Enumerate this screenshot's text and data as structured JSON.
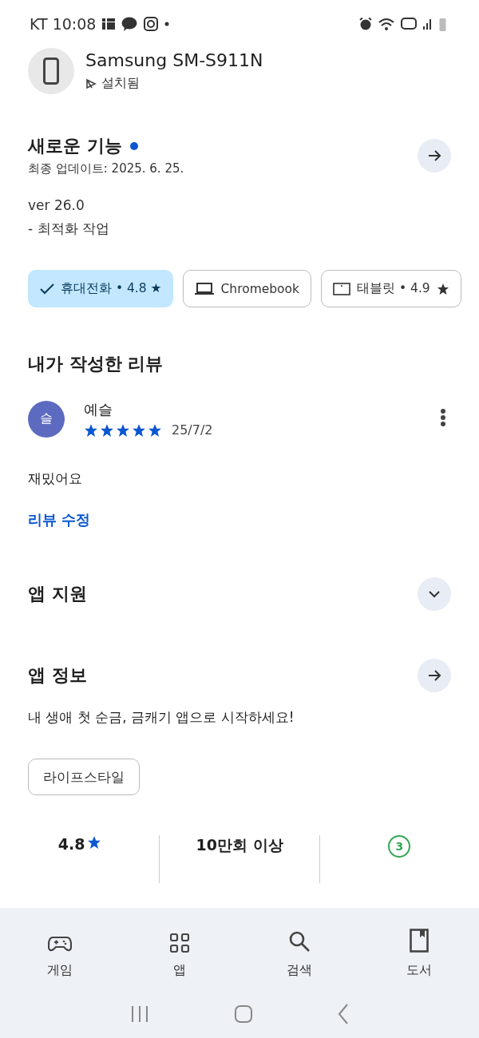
{
  "status_bar": {
    "carrier_time": "KT 10:08"
  },
  "app_header": {
    "title": "Samsung SM-S911N",
    "status": "설치됨"
  },
  "whats_new": {
    "title": "새로운 기능",
    "updated": "최종 업데이트: 2025. 6. 25.",
    "lines": [
      "ver 26.0",
      "- 최적화 작업"
    ]
  },
  "device_chips": [
    {
      "kind": "phone",
      "label": "휴대전화 • 4.8 ★",
      "selected": true
    },
    {
      "kind": "laptop",
      "label": "Chromebook",
      "selected": false
    },
    {
      "kind": "tablet",
      "label": "태블릿 • 4.9",
      "selected": false
    }
  ],
  "my_review": {
    "title": "내가 작성한 리뷰",
    "avatar": "슬",
    "author": "예슬",
    "stars": 5,
    "date": "25/7/2",
    "text": "재밌어요",
    "edit_link": "리뷰 수정"
  },
  "app_support": {
    "title": "앱 지원",
    "expanded": false
  },
  "app_info": {
    "title": "앱 정보",
    "description": "내 생애 첫 순금, 금캐기 앱으로 시작하세요!",
    "category": "라이프스타일"
  },
  "stats": [
    {
      "kind": "rating",
      "value": "4.8"
    },
    {
      "kind": "text",
      "value": "10만회 이상"
    },
    {
      "kind": "age",
      "value": "3"
    }
  ],
  "bottom_nav": [
    {
      "kind": "game",
      "label": "게임"
    },
    {
      "kind": "apps",
      "label": "앱"
    },
    {
      "kind": "search",
      "label": "검색"
    },
    {
      "kind": "book",
      "label": "도서"
    }
  ]
}
